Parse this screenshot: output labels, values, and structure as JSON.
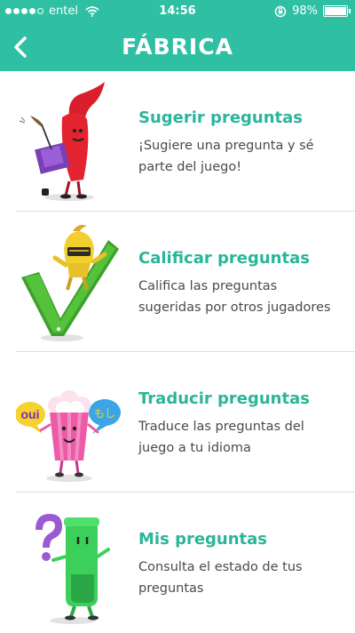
{
  "status_bar": {
    "carrier": "entel",
    "time": "14:56",
    "battery": "98%",
    "battery_level": 0.98
  },
  "nav": {
    "title": "FÁBRICA",
    "back_icon": "chevron-left-icon"
  },
  "colors": {
    "header_bg": "#2fbfa3",
    "title_accent": "#2bb59a",
    "body_text": "#4a4a4a"
  },
  "items": [
    {
      "title": "Sugerir preguntas",
      "description": "¡Sugiere una pregunta y sé parte del juego!",
      "icon": "red-brush-writer-icon"
    },
    {
      "title": "Calificar preguntas",
      "description": "Califica las preguntas sugeridas por otros jugadores",
      "icon": "checkmark-knight-icon"
    },
    {
      "title": "Traducir preguntas",
      "description": "Traduce las preguntas del juego a tu idioma",
      "icon": "translator-popcorn-icon"
    },
    {
      "title": "Mis preguntas",
      "description": "Consulta el estado de tus preguntas",
      "icon": "green-question-character-icon"
    }
  ],
  "bubbles": {
    "left": "oui",
    "right": "もし"
  }
}
